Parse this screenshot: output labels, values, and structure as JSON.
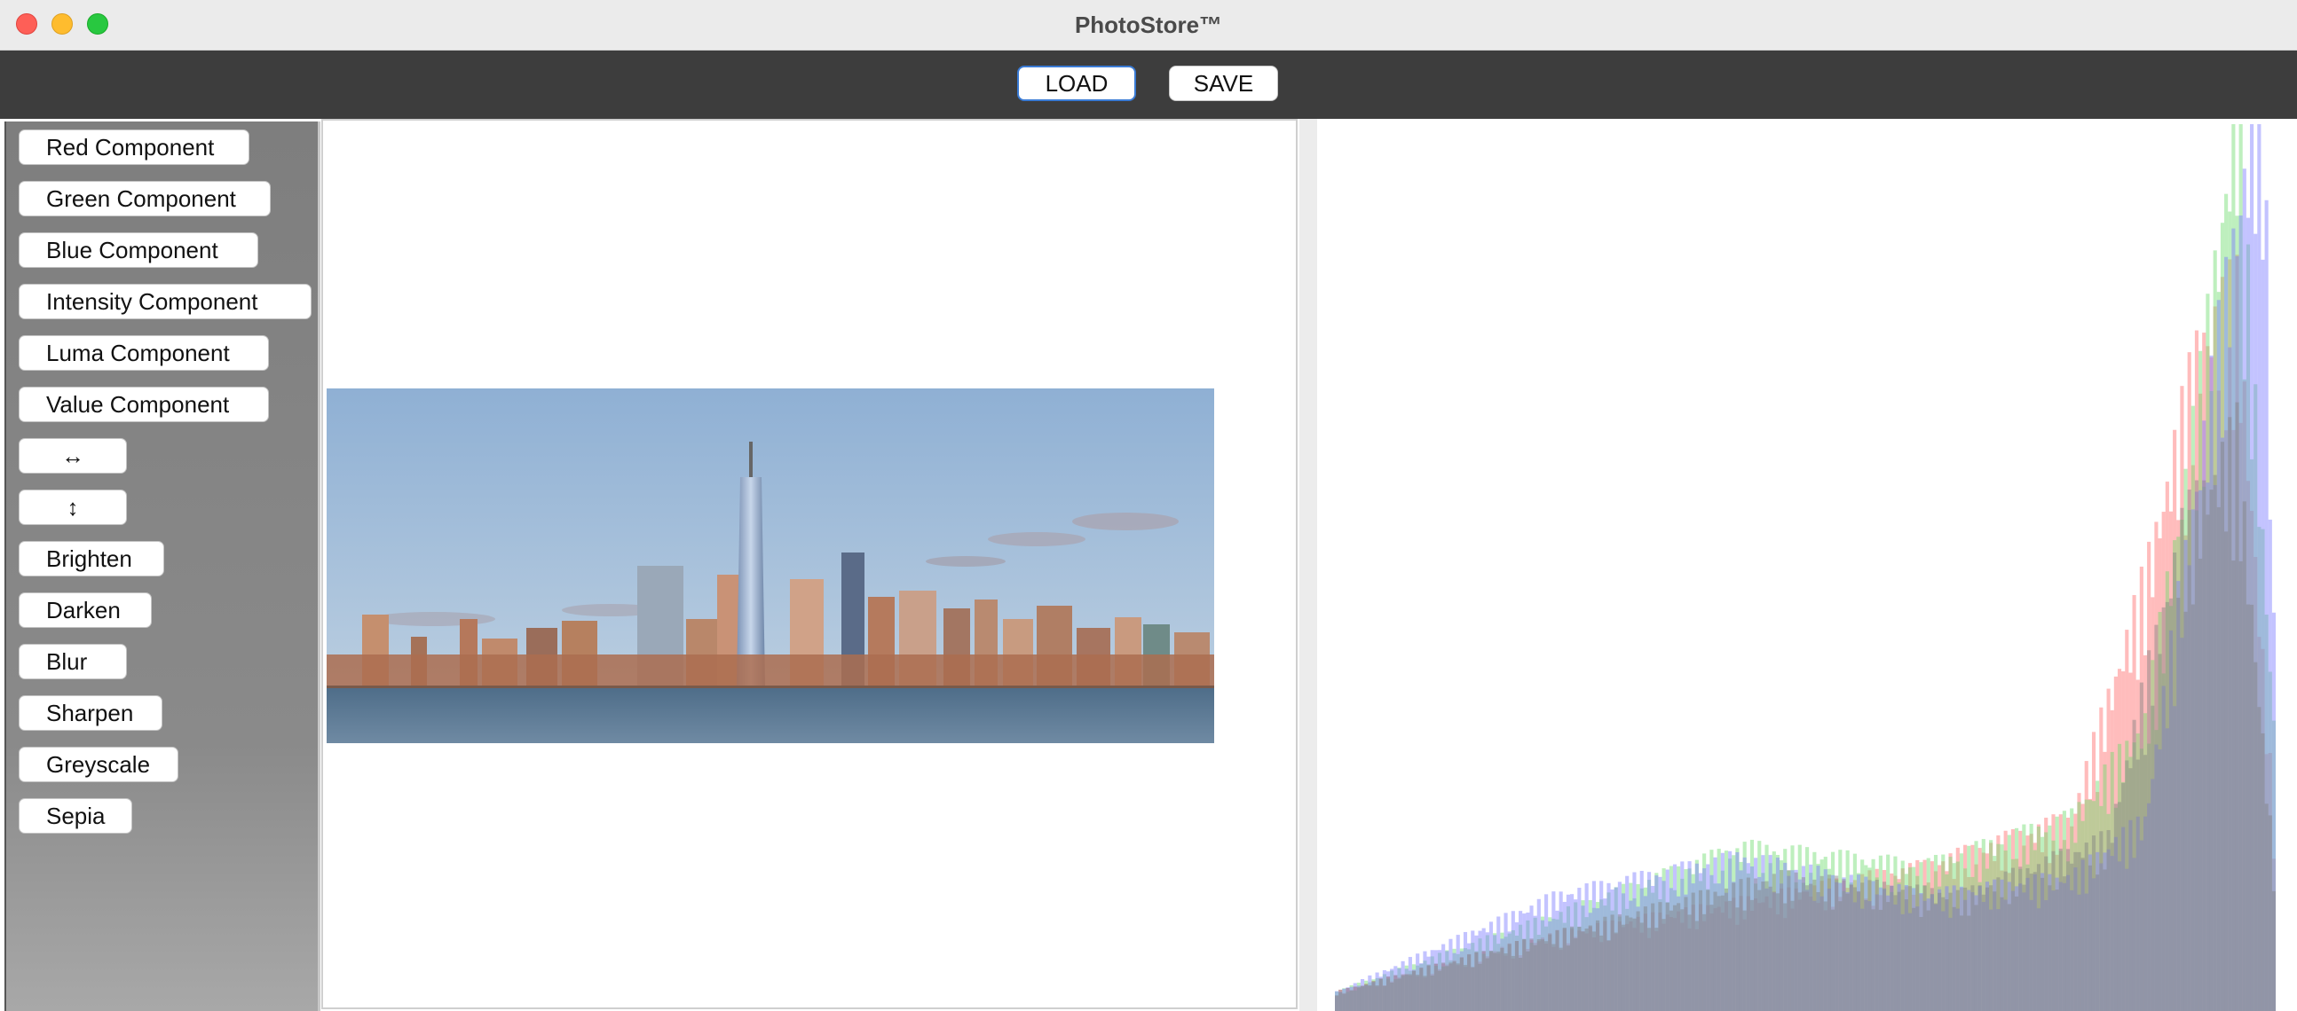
{
  "window": {
    "title": "PhotoStore™"
  },
  "toolbar": {
    "load_label": "LOAD",
    "save_label": "SAVE"
  },
  "sidebar": {
    "buttons": [
      {
        "label": "Red Component"
      },
      {
        "label": "Green Component"
      },
      {
        "label": "Blue Component"
      },
      {
        "label": "Intensity Component"
      },
      {
        "label": "Luma Component"
      },
      {
        "label": "Value Component"
      },
      {
        "label": "↔"
      },
      {
        "label": "↕"
      },
      {
        "label": "Brighten"
      },
      {
        "label": "Darken"
      },
      {
        "label": "Blur"
      },
      {
        "label": "Sharpen"
      },
      {
        "label": "Greyscale"
      },
      {
        "label": "Sepia"
      }
    ]
  },
  "colors": {
    "toolbar_bg": "#3d3d3d",
    "sidebar_bg": "#7e7e7e",
    "hist_red": "#ff6b6b",
    "hist_green": "#6fdc6f",
    "hist_blue": "#7a7aff",
    "hist_intensity": "#808080",
    "load_focus": "#3a7bd5"
  },
  "image": {
    "subject": "city-skyline-photo"
  },
  "histogram": {
    "bins": 256,
    "series": [
      {
        "color": "#ff6b6b",
        "peaks": [
          [
            0,
            0.02
          ],
          [
            60,
            0.08
          ],
          [
            120,
            0.12
          ],
          [
            160,
            0.15
          ],
          [
            200,
            0.2
          ],
          [
            220,
            0.45
          ],
          [
            235,
            0.7
          ],
          [
            245,
            0.75
          ],
          [
            255,
            0.2
          ]
        ]
      },
      {
        "color": "#6fdc6f",
        "peaks": [
          [
            0,
            0.02
          ],
          [
            60,
            0.1
          ],
          [
            110,
            0.17
          ],
          [
            160,
            0.15
          ],
          [
            200,
            0.2
          ],
          [
            220,
            0.3
          ],
          [
            235,
            0.65
          ],
          [
            245,
            0.95
          ],
          [
            255,
            0.3
          ]
        ]
      },
      {
        "color": "#7a7aff",
        "peaks": [
          [
            0,
            0.02
          ],
          [
            60,
            0.12
          ],
          [
            110,
            0.16
          ],
          [
            160,
            0.12
          ],
          [
            200,
            0.14
          ],
          [
            220,
            0.2
          ],
          [
            240,
            0.7
          ],
          [
            252,
            1.0
          ],
          [
            255,
            0.4
          ]
        ]
      },
      {
        "color": "#808080",
        "peaks": [
          [
            0,
            0.02
          ],
          [
            60,
            0.08
          ],
          [
            120,
            0.14
          ],
          [
            170,
            0.12
          ],
          [
            210,
            0.18
          ],
          [
            230,
            0.5
          ],
          [
            245,
            0.6
          ],
          [
            255,
            0.15
          ]
        ]
      }
    ]
  }
}
